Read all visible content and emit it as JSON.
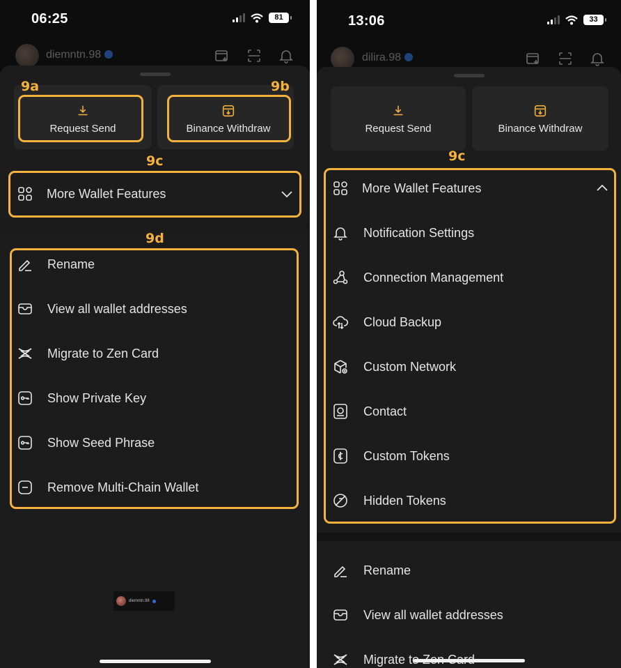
{
  "left": {
    "status": {
      "time": "06:25",
      "battery": "81"
    },
    "header": {
      "username": "diemntn.98"
    },
    "buttons": {
      "request_send": "Request Send",
      "binance_withdraw": "Binance Withdraw"
    },
    "tags": {
      "a": "9a",
      "b": "9b",
      "c": "9c",
      "d": "9d"
    },
    "more_features": {
      "label": "More Wallet Features",
      "expanded": false
    },
    "menu": [
      {
        "label": "Rename",
        "icon": "pencil-icon"
      },
      {
        "label": "View all wallet addresses",
        "icon": "wallet-icon"
      },
      {
        "label": "Migrate to Zen Card",
        "icon": "zen-icon"
      },
      {
        "label": "Show Private Key",
        "icon": "key-icon"
      },
      {
        "label": "Show Seed Phrase",
        "icon": "key-icon"
      },
      {
        "label": "Remove Multi-Chain Wallet",
        "icon": "minus-icon"
      }
    ],
    "footer_username": "diemntn.98"
  },
  "right": {
    "status": {
      "time": "13:06",
      "battery": "33"
    },
    "header": {
      "username": "dilira.98"
    },
    "buttons": {
      "request_send": "Request Send",
      "binance_withdraw": "Binance Withdraw"
    },
    "tags": {
      "c": "9c"
    },
    "more_features": {
      "label": "More Wallet Features",
      "expanded": true
    },
    "features": [
      {
        "label": "Notification Settings",
        "icon": "bell-icon"
      },
      {
        "label": "Connection Management",
        "icon": "nodes-icon"
      },
      {
        "label": "Cloud Backup",
        "icon": "cloud-icon"
      },
      {
        "label": "Custom Network",
        "icon": "cube-icon"
      },
      {
        "label": "Contact",
        "icon": "contact-icon"
      },
      {
        "label": "Custom Tokens",
        "icon": "coin-icon"
      },
      {
        "label": "Hidden Tokens",
        "icon": "hidden-icon"
      }
    ],
    "menu": [
      {
        "label": "Rename",
        "icon": "pencil-icon"
      },
      {
        "label": "View all wallet addresses",
        "icon": "wallet-icon"
      },
      {
        "label": "Migrate to Zen Card",
        "icon": "zen-icon"
      }
    ]
  },
  "colors": {
    "highlight": "#f4b13e",
    "sheet": "#1c1c1c",
    "tile": "#262626",
    "background": "#0d0d0d"
  }
}
